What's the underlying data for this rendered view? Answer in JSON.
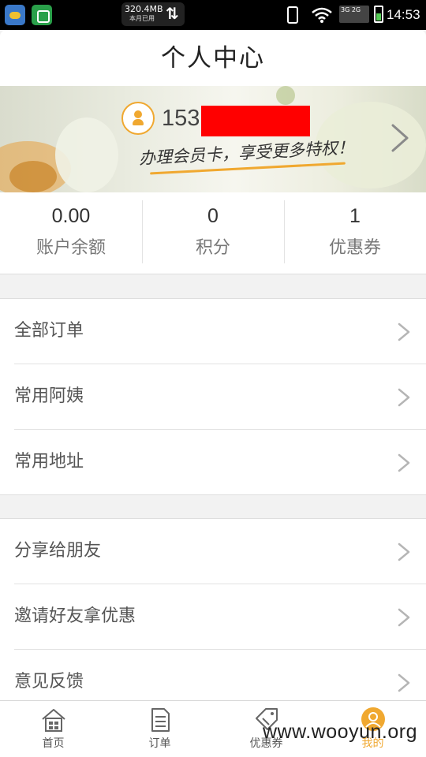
{
  "status_bar": {
    "traffic_amount": "320.4MB",
    "traffic_sub": "本月已用",
    "net_label": "3G 2G",
    "time": "14:53"
  },
  "header": {
    "title": "个人中心"
  },
  "banner": {
    "phone_prefix": "153",
    "slogan": "办理会员卡，享受更多特权！"
  },
  "stats": [
    {
      "value": "0.00",
      "label": "账户余额"
    },
    {
      "value": "0",
      "label": "积分"
    },
    {
      "value": "1",
      "label": "优惠券"
    }
  ],
  "menu_group_1": [
    {
      "label": "全部订单"
    },
    {
      "label": "常用阿姨"
    },
    {
      "label": "常用地址"
    }
  ],
  "menu_group_2": [
    {
      "label": "分享给朋友"
    },
    {
      "label": "邀请好友拿优惠"
    },
    {
      "label": "意见反馈"
    }
  ],
  "tab_bar": [
    {
      "label": "首页",
      "icon": "home-icon"
    },
    {
      "label": "订单",
      "icon": "order-icon"
    },
    {
      "label": "优惠券",
      "icon": "coupon-icon"
    },
    {
      "label": "我的",
      "icon": "profile-icon",
      "active": true
    }
  ],
  "watermark": "www.wooyun.org",
  "colors": {
    "accent": "#f0a830",
    "redaction": "#ff0000",
    "background": "#f2f2f2"
  }
}
